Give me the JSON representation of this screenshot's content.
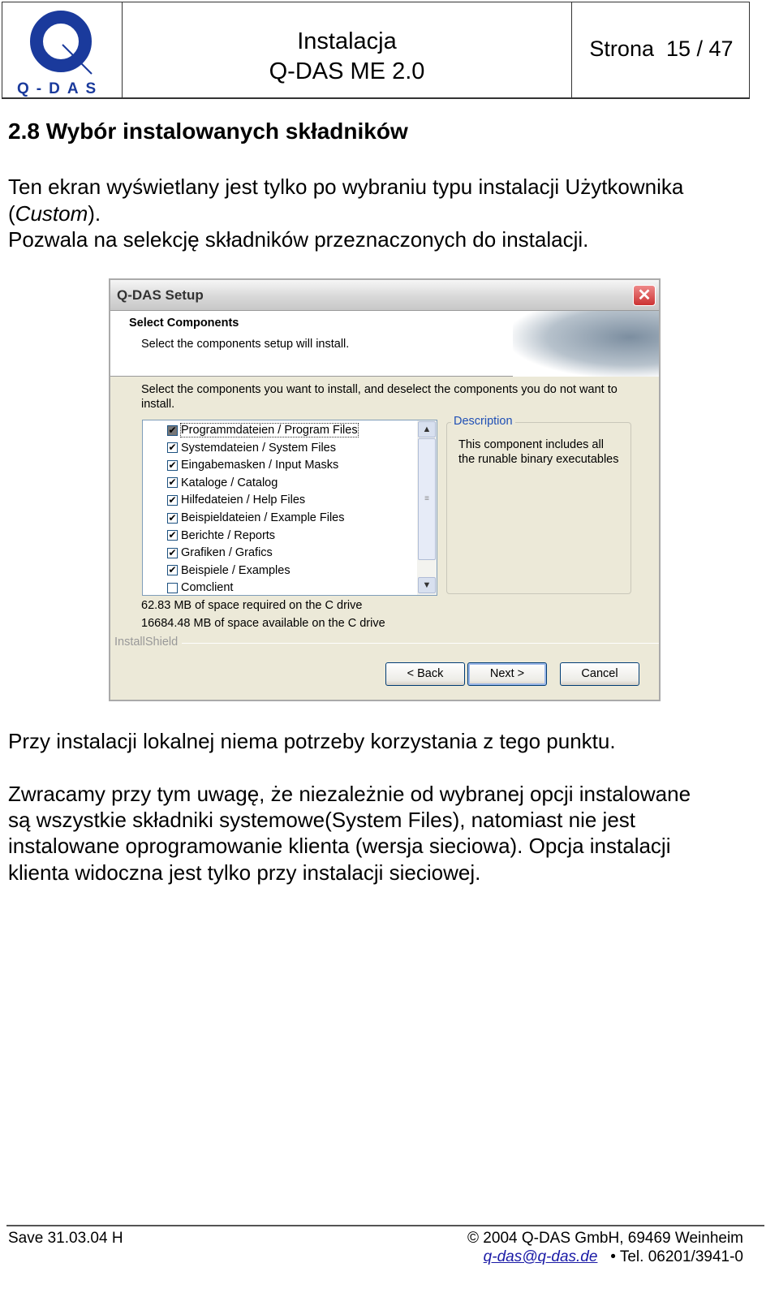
{
  "header": {
    "logo_text": "Q-DAS",
    "title_line1": "Instalacja",
    "title_line2": "Q-DAS ME 2.0",
    "page_label": "Strona",
    "page_value": "15 / 47",
    "brand_color": "#1a3a9c"
  },
  "section": {
    "heading": "2.8 Wybór instalowanych składników",
    "intro_line1": "Ten ekran wyświetlany jest tylko po wybraniu typu instalacji Użytkownika",
    "intro_line2_open": "(",
    "intro_line2_em": "Custom",
    "intro_line2_close": ").",
    "intro_line3": "Pozwala na selekcję składników przeznaczonych do instalacji.",
    "note": "Przy instalacji lokalnej niema potrzeby korzystania z tego punktu.",
    "para": [
      "Zwracamy przy tym uwagę, że niezależnie od wybranej opcji instalowane",
      "są wszystkie składniki systemowe(System Files), natomiast nie jest",
      "instalowane oprogramowanie klienta (wersja sieciowa). Opcja instalacji",
      "klienta widoczna jest tylko przy instalacji sieciowej."
    ]
  },
  "dialog": {
    "title": "Q-DAS Setup",
    "close_icon": "close-icon",
    "heading": "Select Components",
    "subheading": "Select the components setup will install.",
    "instructions_1": "Select the components you want to install, and deselect the components you do not want to",
    "instructions_2": "install.",
    "components": [
      {
        "label": "Programmdateien / Program Files",
        "checked": true,
        "selected": true
      },
      {
        "label": "Systemdateien / System Files",
        "checked": true
      },
      {
        "label": "Eingabemasken / Input Masks",
        "checked": true
      },
      {
        "label": "Kataloge / Catalog",
        "checked": true
      },
      {
        "label": "Hilfedateien / Help Files",
        "checked": true
      },
      {
        "label": "Beispieldateien / Example Files",
        "checked": true
      },
      {
        "label": "Berichte / Reports",
        "checked": true
      },
      {
        "label": "Grafiken / Grafics",
        "checked": true
      },
      {
        "label": "Beispiele / Examples",
        "checked": true
      },
      {
        "label": "Comclient",
        "checked": false
      }
    ],
    "description_label": "Description",
    "description_1": "This component includes all",
    "description_2": "the runable binary executables",
    "space_required": "62.83 MB of space required on the C drive",
    "space_available": "16684.48 MB of space available on the C drive",
    "brand": "InstallShield",
    "back": "< Back",
    "next": "Next >",
    "cancel": "Cancel"
  },
  "footer": {
    "save": "Save 31.03.04 H",
    "copyright": "© 2004  Q-DAS GmbH, 69469 Weinheim",
    "email": "q-das@q-das.de",
    "tel": "•  Tel. 06201/3941-0"
  }
}
